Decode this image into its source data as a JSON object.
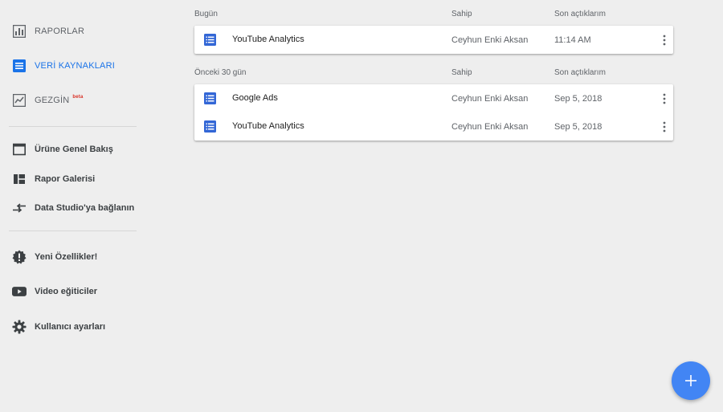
{
  "sidebar": {
    "primary": [
      {
        "label": "RAPORLAR",
        "icon": "bar-chart-icon"
      },
      {
        "label": "VERİ KAYNAKLARI",
        "icon": "data-source-icon"
      },
      {
        "label": "GEZGİN",
        "badge": "beta",
        "icon": "trending-line-icon"
      }
    ],
    "secondary": [
      {
        "label": "Ürüne Genel Bakış",
        "icon": "window-icon"
      },
      {
        "label": "Rapor Galerisi",
        "icon": "gallery-icon"
      },
      {
        "label": "Data Studio'ya bağlanın",
        "icon": "connect-arrows-icon"
      }
    ],
    "tertiary": [
      {
        "label": "Yeni Özellikler!",
        "icon": "new-features-badge-icon"
      },
      {
        "label": "Video eğiticiler",
        "icon": "video-icon"
      },
      {
        "label": "Kullanıcı ayarları",
        "icon": "gear-icon"
      }
    ]
  },
  "sections": [
    {
      "title": "Bugün",
      "col_owner": "Sahip",
      "col_opened": "Son açtıklarım",
      "rows": [
        {
          "name": "YouTube Analytics",
          "owner": "Ceyhun Enki Aksan",
          "opened": "11:14 AM"
        }
      ]
    },
    {
      "title": "Önceki 30 gün",
      "col_owner": "Sahip",
      "col_opened": "Son açtıklarım",
      "rows": [
        {
          "name": "Google Ads",
          "owner": "Ceyhun Enki Aksan",
          "opened": "Sep 5, 2018"
        },
        {
          "name": "YouTube Analytics",
          "owner": "Ceyhun Enki Aksan",
          "opened": "Sep 5, 2018"
        }
      ]
    }
  ],
  "colors": {
    "accent": "#1a73e8",
    "fab": "#4285f4",
    "doc_icon": "#3367d6",
    "beta": "#d93025"
  },
  "fab_icon": "plus-icon"
}
